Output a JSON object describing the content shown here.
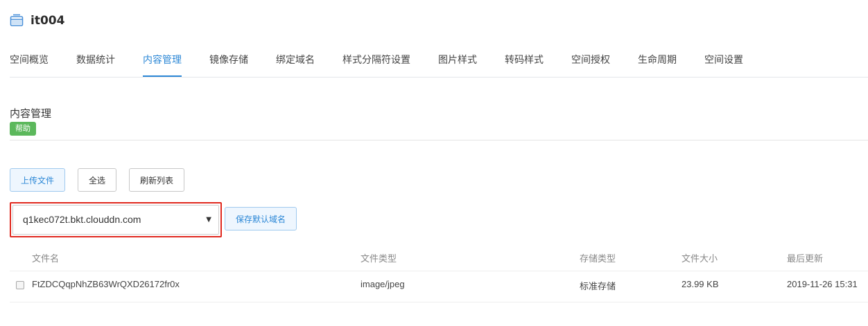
{
  "header": {
    "bucket_name": "it004",
    "icon": "bucket-icon"
  },
  "tabs": [
    {
      "label": "空间概览",
      "active": false
    },
    {
      "label": "数据统计",
      "active": false
    },
    {
      "label": "内容管理",
      "active": true
    },
    {
      "label": "镜像存储",
      "active": false
    },
    {
      "label": "绑定域名",
      "active": false
    },
    {
      "label": "样式分隔符设置",
      "active": false
    },
    {
      "label": "图片样式",
      "active": false
    },
    {
      "label": "转码样式",
      "active": false
    },
    {
      "label": "空间授权",
      "active": false
    },
    {
      "label": "生命周期",
      "active": false
    },
    {
      "label": "空间设置",
      "active": false
    }
  ],
  "section": {
    "title": "内容管理",
    "help_label": "帮助"
  },
  "toolbar": {
    "upload_label": "上传文件",
    "select_all_label": "全选",
    "refresh_label": "刷新列表"
  },
  "domain": {
    "selected": "q1kec072t.bkt.clouddn.com",
    "save_default_label": "保存默认域名"
  },
  "table": {
    "columns": [
      "文件名",
      "文件类型",
      "存储类型",
      "文件大小",
      "最后更新"
    ],
    "rows": [
      {
        "name": "FtZDCQqpNhZB63WrQXD26172fr0x",
        "type": "image/jpeg",
        "storage": "标准存储",
        "size": "23.99 KB",
        "updated": "2019-11-26 15:31"
      }
    ]
  },
  "colors": {
    "accent": "#2b87d6",
    "help_badge": "#5cb85c",
    "highlight_border": "#e0281e"
  }
}
